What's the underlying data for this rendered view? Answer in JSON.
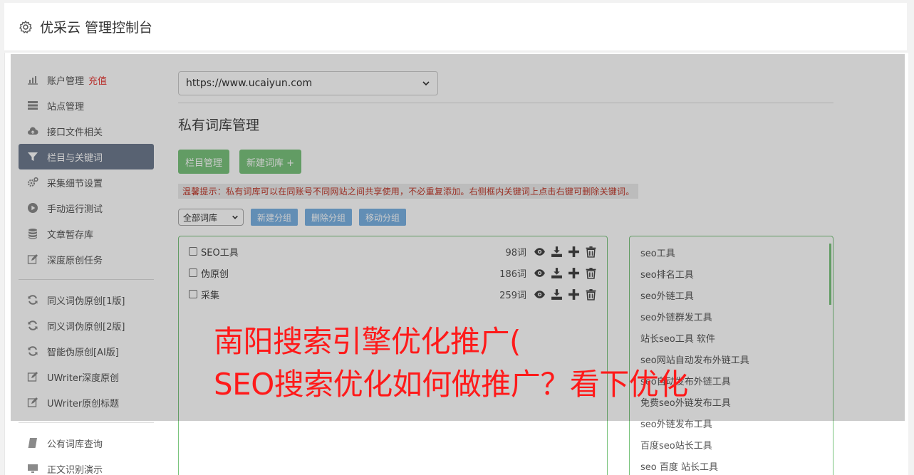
{
  "header": {
    "title": "优采云 管理控制台"
  },
  "sidebar": {
    "items": [
      {
        "label": "账户管理",
        "badge": "充值",
        "icon": "bar-chart-icon"
      },
      {
        "label": "站点管理",
        "icon": "server-icon"
      },
      {
        "label": "接口文件相关",
        "icon": "cloud-upload-icon"
      },
      {
        "label": "栏目与关键词",
        "icon": "filter-icon",
        "active": true
      },
      {
        "label": "采集细节设置",
        "icon": "gears-icon"
      },
      {
        "label": "手动运行测试",
        "icon": "play-circle-icon"
      },
      {
        "label": "文章暂存库",
        "icon": "database-icon"
      },
      {
        "label": "深度原创任务",
        "icon": "edit-icon"
      }
    ],
    "items2": [
      {
        "label": "同义词伪原创[1版]",
        "icon": "refresh-icon"
      },
      {
        "label": "同义词伪原创[2版]",
        "icon": "refresh-icon"
      },
      {
        "label": "智能伪原创[AI版]",
        "icon": "refresh-icon"
      },
      {
        "label": "UWriter深度原创",
        "icon": "edit-icon"
      },
      {
        "label": "UWriter原创标题",
        "icon": "edit-icon"
      }
    ],
    "items3": [
      {
        "label": "公有词库查询",
        "icon": "book-icon"
      },
      {
        "label": "正文识别演示",
        "icon": "monitor-icon"
      }
    ]
  },
  "main": {
    "site_select": "https://www.ucaiyun.com",
    "page_title": "私有词库管理",
    "buttons": {
      "column_manage": "栏目管理",
      "new_library": "新建词库 +"
    },
    "tip": "温馨提示：私有词库可以在同账号不同网站之间共享使用，不必重复添加。右侧框内关键词上点击右键可删除关键词。",
    "group_select": "全部词库",
    "group_buttons": {
      "new_group": "新建分组",
      "delete_group": "删除分组",
      "move_group": "移动分组"
    },
    "libraries": [
      {
        "name": "SEO工具",
        "count": "98词"
      },
      {
        "name": "伪原创",
        "count": "186词"
      },
      {
        "name": "采集",
        "count": "259词"
      }
    ],
    "keywords": [
      "seo工具",
      "seo排名工具",
      "seo外链工具",
      "seo外链群发工具",
      "站长seo工具 软件",
      "seo网站自动发布外链工具",
      "seo自动发布外链工具",
      "免费seo外链发布工具",
      "seo外链发布工具",
      "百度seo站长工具",
      "seo 百度 站长工具"
    ]
  },
  "overlay_headline": {
    "line1": "南阳搜索引擎优化推广(",
    "line2": "SEO搜索优化如何做推广？看下优化"
  },
  "colors": {
    "accent_green": "#7bc47e",
    "accent_blue": "#7bb2e3",
    "active_nav": "#6f7b8f",
    "headline_red": "#ff1a1a"
  }
}
